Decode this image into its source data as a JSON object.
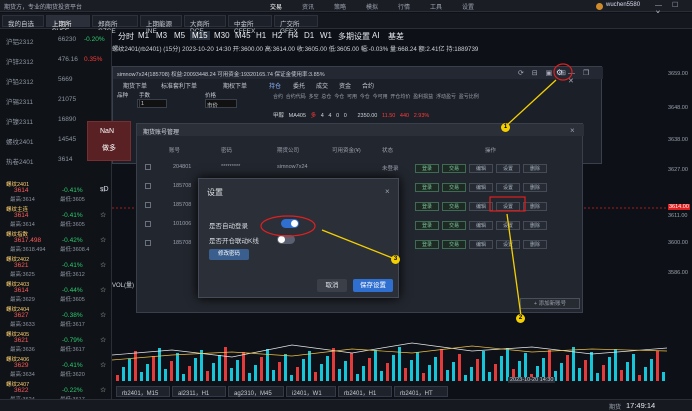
{
  "topbar": {
    "app_name": "期货方，专业的期货投资平台",
    "nav": [
      "交易",
      "资讯",
      "策略",
      "模拟",
      "行情",
      "工具",
      "设置"
    ],
    "user": "wuchen5580"
  },
  "exchange_tabs": [
    "我的自选",
    "上期所 SHFE",
    "郑商所 CZCE",
    "上期能源 INE",
    "大商所 DCE",
    "中金所 CFFEX",
    "广交所 GFEX"
  ],
  "sidebar": [
    {
      "name": "沪铝2312",
      "val": "66230",
      "pct": "-0.20%"
    },
    {
      "name": "沪锌2312",
      "val": "476.16",
      "pct": "0.35%"
    },
    {
      "name": "沪铅2312",
      "val": "5669",
      "pct": ""
    },
    {
      "name": "沪锡2311",
      "val": "21075",
      "pct": ""
    },
    {
      "name": "沪镍2311",
      "val": "16890",
      "pct": ""
    },
    {
      "name": "螺纹2401",
      "val": "14545",
      "pct": ""
    },
    {
      "name": "热卷2401",
      "val": "3614",
      "pct": ""
    }
  ],
  "sidebar_quotes": [
    {
      "name": "螺纹2401",
      "price": "3614",
      "pct": "-0.41%",
      "hi": "最高:3614",
      "lo": "最低:3605"
    },
    {
      "name": "螺纹主连",
      "price": "3614",
      "pct": "-0.41%",
      "hi": "最高:3614",
      "lo": "最低:3605"
    },
    {
      "name": "螺纹指数",
      "price": "3617.498",
      "pct": "-0.42%",
      "hi": "最高:3618.494",
      "lo": "最低:3608.4"
    },
    {
      "name": "螺纹2402",
      "price": "3621",
      "pct": "-0.41%",
      "hi": "最高:3625",
      "lo": "最低:3612"
    },
    {
      "name": "螺纹2403",
      "price": "3614",
      "pct": "-0.44%",
      "hi": "最高:3629",
      "lo": "最低:3605"
    },
    {
      "name": "螺纹2404",
      "price": "3627",
      "pct": "-0.38%",
      "hi": "最高:3633",
      "lo": "最低:3617"
    },
    {
      "name": "螺纹2405",
      "price": "3621",
      "pct": "-0.79%",
      "hi": "最高:3636",
      "lo": "最低:3617"
    },
    {
      "name": "螺纹2406",
      "price": "3629",
      "pct": "-0.41%",
      "hi": "最高:3634",
      "lo": "最低:3620"
    },
    {
      "name": "螺纹2407",
      "price": "3622",
      "pct": "-0.22%",
      "hi": "最高:3624",
      "lo": "最低:3617"
    }
  ],
  "periods": [
    "分时",
    "M1",
    "M3",
    "M5",
    "M15",
    "M30",
    "M45",
    "H1",
    "H2",
    "H4",
    "D1",
    "W1",
    "多期设置",
    "AI",
    "基差"
  ],
  "active_period": "M15",
  "infoline": "螺纹2401(rb2401) (15分)   2023-10-20 14:30   开:3600.00   高:3614.00   收:3605.00   低:3605.00   幅:-0.03%   量:668.24   额:2.41亿   持:1889739",
  "trade_window": {
    "header": "simnow7x24(185708) 权益:20093448.24 可用资金:19320165.74 保证金使用率:3.85%",
    "left_tabs": [
      "期货下单",
      "标准套利下单",
      "期权下单"
    ],
    "right_tabs": [
      "持仓",
      "委托",
      "成交",
      "资金",
      "合约"
    ],
    "cols": [
      "品种",
      "手数",
      "价格"
    ],
    "fields": {
      "product": "rb",
      "qty": "1",
      "price": "市价"
    },
    "pos_headers": [
      "合约",
      "合约代码",
      "多空",
      "总仓",
      "今仓",
      "可用",
      "今仓",
      "今可用",
      "开仓均价",
      "盈利损益",
      "浮动盈亏",
      "盈亏比例"
    ],
    "pos_row": [
      "甲醇",
      "MA405",
      "多",
      "4",
      "4",
      "0",
      "0",
      "",
      "2350.00",
      "11.50",
      "440",
      "2.93%"
    ],
    "nan_label": "NaN",
    "buy_label": "做多",
    "sd_label": "sD"
  },
  "account_modal": {
    "title": "期货账号管理",
    "headers": [
      "",
      "账号",
      "密码",
      "期货公司",
      "可用资金(¥)",
      "状态",
      "操作"
    ],
    "rows": [
      {
        "acct": "204801",
        "pwd": "*********",
        "co": "simnow7x24",
        "funds": "",
        "status": "未登录"
      },
      {
        "acct": "185708",
        "pwd": "",
        "co": "",
        "funds": "",
        "status": ""
      },
      {
        "acct": "185708",
        "pwd": "",
        "co": "",
        "funds": "",
        "status": ""
      },
      {
        "acct": "101006",
        "pwd": "",
        "co": "",
        "funds": "",
        "status": ""
      },
      {
        "acct": "185708",
        "pwd": "",
        "co": "",
        "funds": "",
        "status": ""
      }
    ],
    "ops": [
      "登录",
      "交易",
      "编辑",
      "设置",
      "删除"
    ],
    "add_label": "+ 添加新账号"
  },
  "settings": {
    "title": "设置",
    "auto_login_label": "是否自动登录",
    "kline_label": "是否开仓联动K线",
    "modify_pwd": "修改密码",
    "cancel": "取消",
    "save": "保存设置",
    "auto_login_on": true,
    "kline_on": false
  },
  "price_axis": [
    "3659.00",
    "3648.00",
    "3638.00",
    "3627.00",
    "3614.00",
    "3611.00",
    "3600.00",
    "3586.00"
  ],
  "chart_date_label": "2023-10-20 14:30",
  "vol_label": "VOL(量)",
  "bottom_tabs": [
    "rb2401，M15",
    "al2311，H1",
    "ag2310，M45",
    "i2401，W1",
    "rb2401，H1",
    "rb2401，HT"
  ],
  "status": {
    "clock_label": "期货",
    "clock": "17:49:14"
  },
  "annotations": [
    "1",
    "2",
    "3"
  ],
  "colors": {
    "up": "#ff3b3b",
    "down": "#2ecc71",
    "accent": "#2f6fd0",
    "highlight": "#e02020",
    "arrow": "#f5d000"
  }
}
